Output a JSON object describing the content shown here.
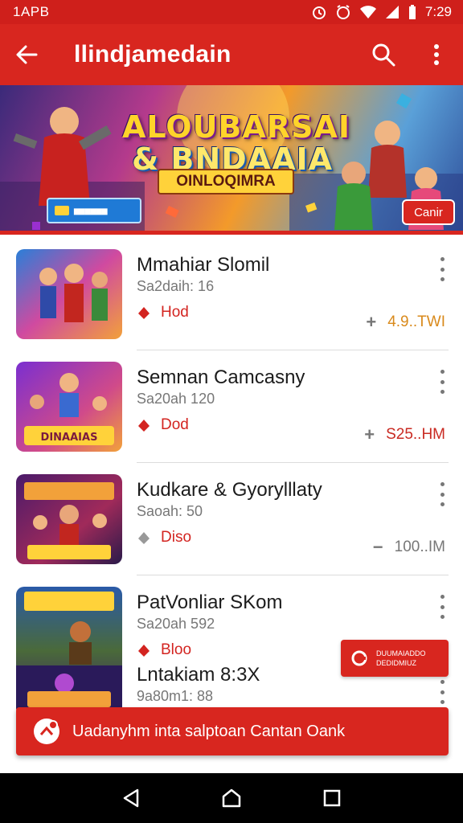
{
  "status_bar": {
    "time": "7:29",
    "left_text": "1APB"
  },
  "app_bar": {
    "title": "llindjamedain",
    "icons": [
      "back-arrow-icon",
      "search-icon",
      "more-vert-icon"
    ]
  },
  "banner": {
    "title_line1": "ALOUBARSAI",
    "title_line2": "& BNDAAIA",
    "title_line3": "OINLOQIMRA",
    "badge_text": "▆▆▆▆▆▆",
    "cta_label": "Canir"
  },
  "items": [
    {
      "title": "Mmahiar Slomil",
      "subtitle": "Sa2daih: 16",
      "tag": "Hod",
      "tag_icon": "fire-icon",
      "stat_sign": "+",
      "stat": "4.9..TWI",
      "stat_color": "#d98a1c"
    },
    {
      "title": "Semnan Camcasny",
      "subtitle": "Sa20ah 120",
      "tag": "Dod",
      "tag_icon": "fire-icon",
      "stat_sign": "+",
      "stat": "S25..HM",
      "stat_color": "#c92a22"
    },
    {
      "title": "Kudkare & Gyorylllaty",
      "subtitle": "Saoah: 50",
      "tag": "Diso",
      "tag_icon": "fire-icon",
      "stat_sign": "−",
      "stat": "100..IM",
      "stat_color": "#777777"
    },
    {
      "title": "PatVonliar SKom",
      "subtitle": "Sa20ah 592",
      "tag": "Bloo",
      "tag_icon": "fire-icon"
    },
    {
      "title": "Lntakiam 8:3X",
      "subtitle": "9a80m1: 88"
    }
  ],
  "promo_button": {
    "line1": "DUUMAIADDO",
    "line2": "DEDIDMIUZ"
  },
  "snackbar": {
    "text": "Uadanyhm inta salptoan Cantan Oank"
  },
  "nav": {
    "icons": [
      "back-triangle-icon",
      "home-circle-icon",
      "recents-square-icon"
    ]
  },
  "colors": {
    "primary": "#d8261f",
    "status_bar": "#cf1f1b",
    "accent_orange": "#d98a1c"
  }
}
